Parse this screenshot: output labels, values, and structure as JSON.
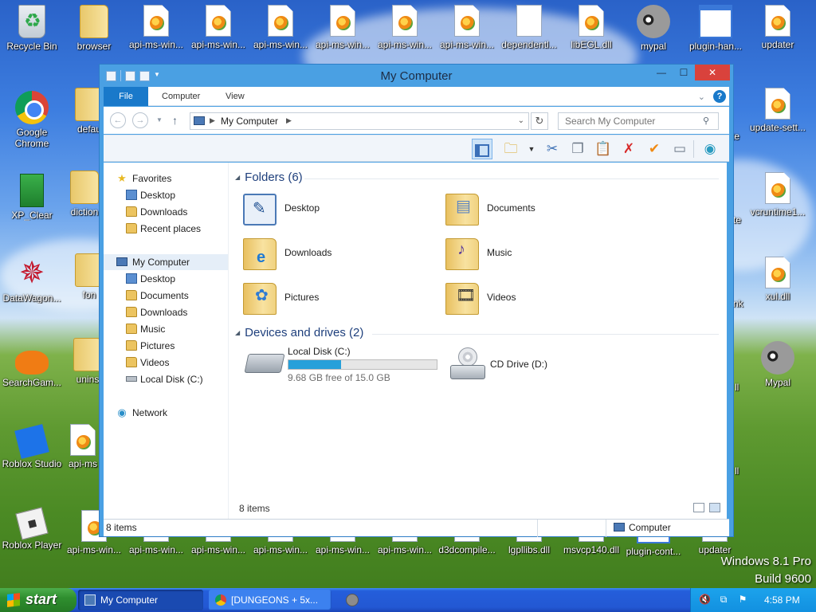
{
  "desktop": {
    "icons_top_row": [
      "Recycle Bin",
      "browser",
      "api-ms-win...",
      "api-ms-win...",
      "api-ms-win...",
      "api-ms-win...",
      "api-ms-win...",
      "api-ms-win...",
      "dependentl...",
      "libEGL.dll",
      "mypal",
      "plugin-han...",
      "updater"
    ],
    "icons_left_col": [
      "Google Chrome",
      "XP_Clear",
      "DataWagon...",
      "SearchGam...",
      "Roblox Studio",
      "Roblox Player"
    ],
    "icons_second_col_partial": [
      "defau",
      "diction",
      "fon",
      "unins",
      "api-ms"
    ],
    "icons_right_col": [
      "update-sett...",
      "vcruntime1...",
      "xul.dll",
      "Mypal"
    ],
    "icons_right_partial": [
      "te",
      "nk",
      "ll",
      "ll"
    ],
    "icons_bottom_row": [
      "api-ms-win...",
      "api-ms-win...",
      "api-ms-win...",
      "api-ms-win...",
      "api-ms-win...",
      "api-ms-win...",
      "d3dcompile...",
      "lgpllibs.dll",
      "msvcp140.dll",
      "plugin-cont...",
      "updater"
    ]
  },
  "window": {
    "title": "My Computer",
    "controls": {
      "minimize": "—",
      "maximize": "☐",
      "close": "✕"
    },
    "ribbon_tabs": [
      "File",
      "Computer",
      "View"
    ],
    "help_label": "?",
    "address": {
      "location": "My Computer"
    },
    "search": {
      "placeholder": "Search My Computer"
    },
    "nav_pane": {
      "favorites_label": "Favorites",
      "favorites": [
        "Desktop",
        "Downloads",
        "Recent places"
      ],
      "computer_label": "My Computer",
      "computer_items": [
        "Desktop",
        "Documents",
        "Downloads",
        "Music",
        "Pictures",
        "Videos",
        "Local Disk (C:)"
      ],
      "network_label": "Network"
    },
    "folders_header": "Folders (6)",
    "folders": [
      "Desktop",
      "Documents",
      "Downloads",
      "Music",
      "Pictures",
      "Videos"
    ],
    "devices_header": "Devices and drives (2)",
    "drives": [
      {
        "name": "Local Disk (C:)",
        "free_text": "9.68 GB free of 15.0 GB",
        "used_fraction": 0.355
      },
      {
        "name": "CD Drive (D:)"
      }
    ],
    "item_count": "8 items",
    "status_count": "8 items",
    "status_location": "Computer"
  },
  "watermark": {
    "line1": "Windows 8.1 Pro",
    "line2": "Build 9600"
  },
  "taskbar": {
    "start_label": "start",
    "tasks": [
      "My Computer",
      "[DUNGEONS + 5x..."
    ],
    "clock": "4:58 PM"
  },
  "colors": {
    "accent": "#1979ca",
    "window_frame": "#4aa0e3",
    "taskbar": "#245edb",
    "start": "#2f8f2f"
  }
}
